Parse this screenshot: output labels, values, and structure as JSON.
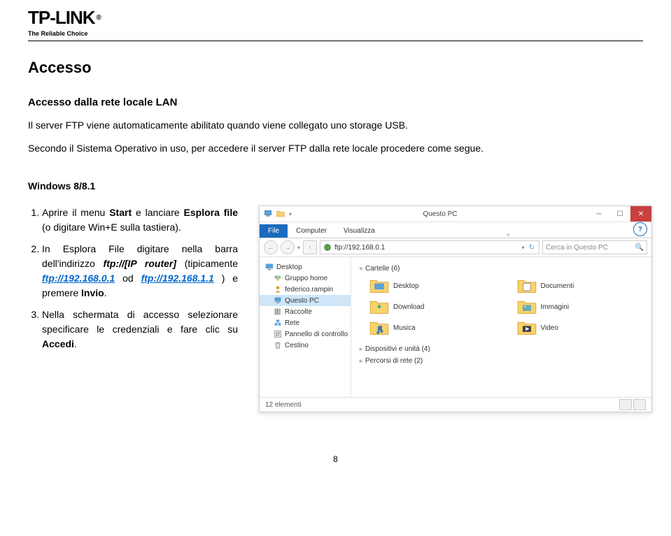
{
  "logo": {
    "brand": "TP-LINK",
    "tagline": "The Reliable Choice"
  },
  "heading": "Accesso",
  "subheading": "Accesso dalla rete locale LAN",
  "intro1": "Il server FTP viene automaticamente abilitato quando viene collegato uno storage USB.",
  "intro2": "Secondo il Sistema Operativo in uso, per accedere il server FTP dalla rete locale procedere come segue.",
  "os_heading": "Windows 8/8.1",
  "steps": {
    "s1_a": "Aprire il menu ",
    "s1_b": "Start",
    "s1_c": " e lanciare ",
    "s1_d": "Esplora file",
    "s1_e": " (o digitare Win+E sulla tastiera).",
    "s2_a": "In Esplora File digitare nella barra dell'indirizzo ",
    "s2_b": "ftp://[IP router]",
    "s2_c": " (tipicamente ",
    "s2_link1": "ftp://192.168.0.1",
    "s2_d": " od ",
    "s2_link2": "ftp://192.168.1.1",
    "s2_e": " ) e premere ",
    "s2_f": "Invio",
    "s2_g": ".",
    "s3_a": "Nella schermata di accesso selezionare specificare le credenziali e fare clic su ",
    "s3_b": "Accedi",
    "s3_c": "."
  },
  "screenshot": {
    "window_title": "Questo PC",
    "tabs": {
      "file": "File",
      "computer": "Computer",
      "visualizza": "Visualizza"
    },
    "address": "ftp://192.168.0.1",
    "search_placeholder": "Cerca in Questo PC",
    "sidebar": {
      "desktop": "Desktop",
      "gruppo_home": "Gruppo home",
      "user": "federico.rampin",
      "questo_pc": "Questo PC",
      "raccolte": "Raccolte",
      "rete": "Rete",
      "pannello": "Pannello di controllo",
      "cestino": "Cestino"
    },
    "sections": {
      "cartelle": "Cartelle (6)",
      "dispositivi": "Dispositivi e unità (4)",
      "percorsi": "Percorsi di rete (2)"
    },
    "folders": {
      "desktop": "Desktop",
      "documenti": "Documenti",
      "download": "Download",
      "immagini": "Immagini",
      "musica": "Musica",
      "video": "Video"
    },
    "status": "12 elementi"
  },
  "page_number": "8"
}
